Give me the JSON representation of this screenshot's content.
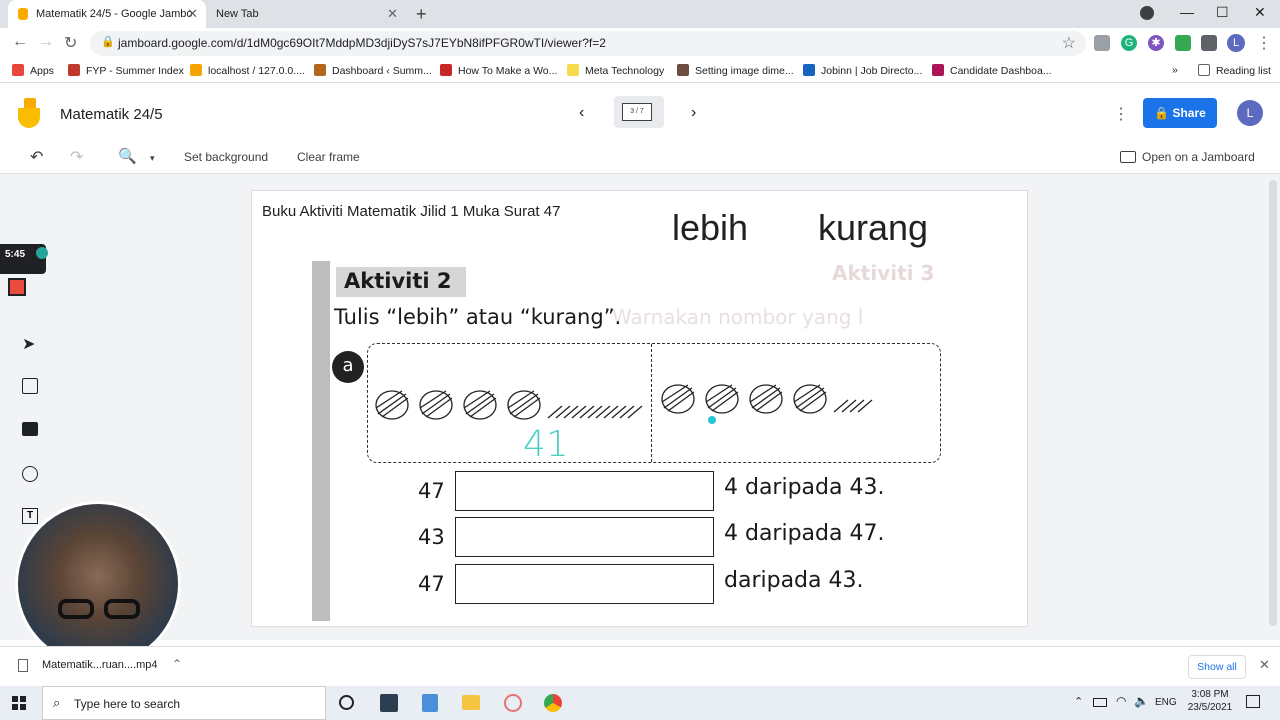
{
  "browser": {
    "tabs": [
      {
        "title": "Matematik 24/5 - Google Jambo",
        "active": true
      },
      {
        "title": "New Tab",
        "active": false
      }
    ],
    "url": "jamboard.google.com/d/1dM0gc69OIt7MddpMD3djiDyS7sJ7EYbN8ifPFGR0wTI/viewer?f=2",
    "profile_initial": "L",
    "bookmarks": [
      {
        "label": "Apps",
        "color": "#e8453c"
      },
      {
        "label": "FYP - Summer Index",
        "color": "#c0392b"
      },
      {
        "label": "localhost / 127.0.0....",
        "color": "#f4a300"
      },
      {
        "label": "Dashboard ‹ Summ...",
        "color": "#b5651d"
      },
      {
        "label": "How To Make a Wo...",
        "color": "#c62828"
      },
      {
        "label": "Meta Technology",
        "color": "#f7d94c"
      },
      {
        "label": "Setting image dime...",
        "color": "#6d4c41"
      },
      {
        "label": "Jobinn | Job Directo...",
        "color": "#1565c0"
      },
      {
        "label": "Candidate Dashboa...",
        "color": "#ad1457"
      }
    ],
    "reading_list": "Reading list",
    "more_bookmarks": "»"
  },
  "jamboard": {
    "title": "Matematik 24/5",
    "frame_indicator": "3 / 7",
    "share_label": "Share",
    "avatar_initial": "L",
    "toolbar": {
      "set_background": "Set background",
      "clear_frame": "Clear frame",
      "open_on_jamboard": "Open on a Jamboard"
    },
    "recording_time": "5:45",
    "frame": {
      "sticky_text": "Buku Aktiviti Matematik Jilid 1 Muka Surat 47",
      "word_more": "lebih",
      "word_less": "kurang",
      "book": {
        "activity": "Aktiviti 2",
        "instruction": "Tulis “lebih” atau “kurang”.",
        "label_a": "a",
        "handwritten": "41",
        "rows": [
          {
            "number": "47",
            "suffix": "4 daripada 43."
          },
          {
            "number": "43",
            "suffix": "4 daripada 47."
          },
          {
            "number": "47",
            "suffix": "daripada 43."
          }
        ],
        "bg_text_1": "Aktiviti 3",
        "bg_text_2": "Warnakan nombor yang l"
      }
    }
  },
  "downloads": {
    "file": "Matematik...ruan....mp4",
    "show_all": "Show all"
  },
  "taskbar": {
    "search_placeholder": "Type here to search",
    "language": "ENG",
    "time": "3:08 PM",
    "date": "23/5/2021"
  }
}
